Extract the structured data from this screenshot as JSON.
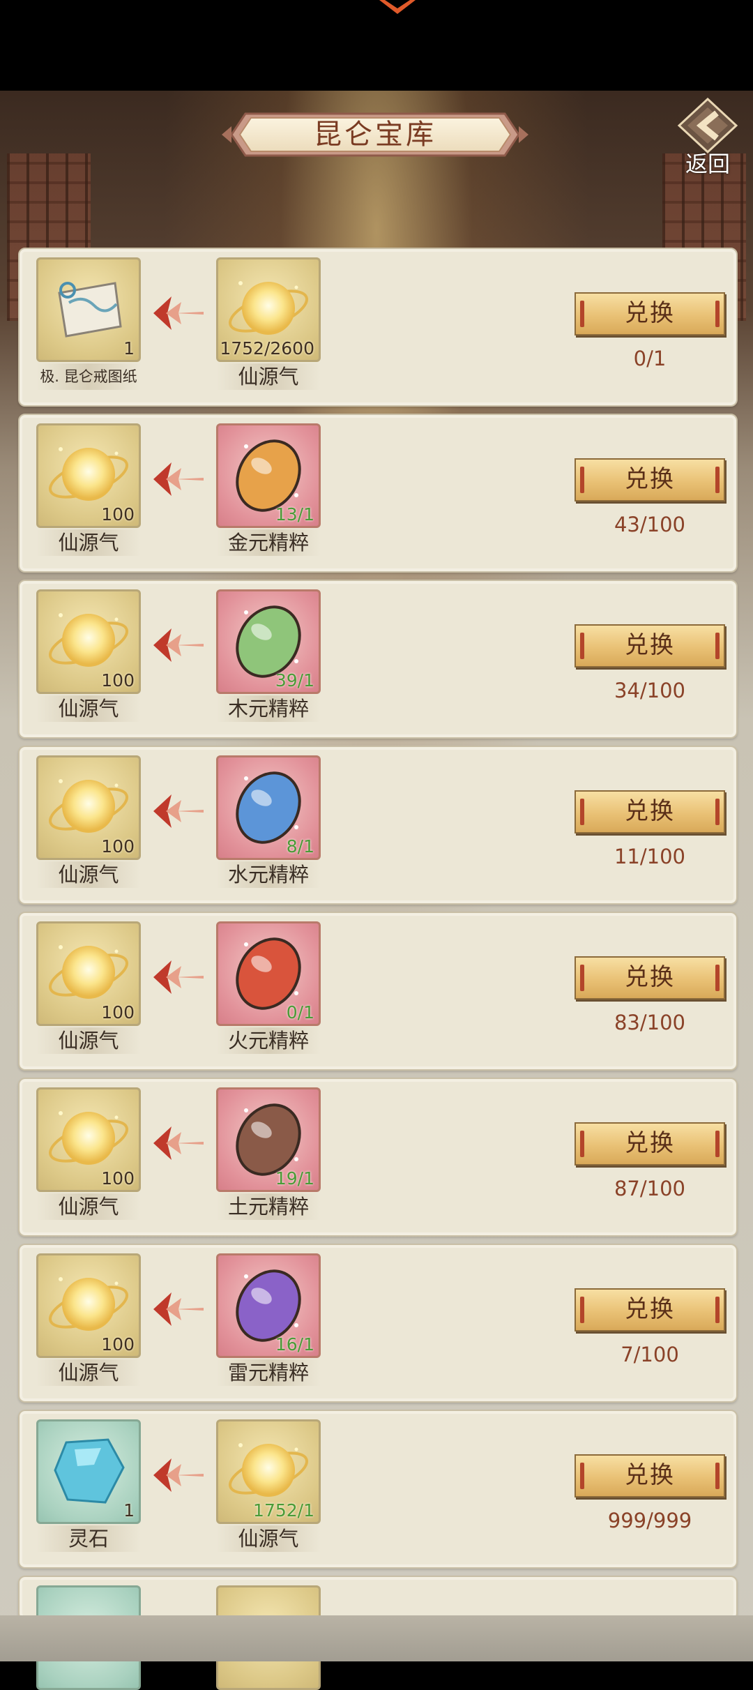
{
  "header": {
    "title": "昆仑宝库",
    "back_label": "返回"
  },
  "rows": [
    {
      "left": {
        "name": "极. 昆仑戒图纸",
        "count": "1",
        "type": "gold",
        "icon": "blueprint-icon"
      },
      "right": {
        "name": "仙源气",
        "count": "1752/2600",
        "type": "gold",
        "icon": "xianyuanqi-orb-icon"
      },
      "button": "兑换",
      "progress": "0/1"
    },
    {
      "left": {
        "name": "仙源气",
        "count": "100",
        "type": "gold",
        "icon": "xianyuanqi-orb-icon"
      },
      "right": {
        "name": "金元精粹",
        "count": "13/1",
        "type": "pink",
        "icon": "gold-essence-gem-icon",
        "gem": "#e7a24a"
      },
      "button": "兑换",
      "progress": "43/100"
    },
    {
      "left": {
        "name": "仙源气",
        "count": "100",
        "type": "gold",
        "icon": "xianyuanqi-orb-icon"
      },
      "right": {
        "name": "木元精粹",
        "count": "39/1",
        "type": "pink",
        "icon": "wood-essence-gem-icon",
        "gem": "#8fc57a"
      },
      "button": "兑换",
      "progress": "34/100"
    },
    {
      "left": {
        "name": "仙源气",
        "count": "100",
        "type": "gold",
        "icon": "xianyuanqi-orb-icon"
      },
      "right": {
        "name": "水元精粹",
        "count": "8/1",
        "type": "pink",
        "icon": "water-essence-gem-icon",
        "gem": "#5c95d8"
      },
      "button": "兑换",
      "progress": "11/100"
    },
    {
      "left": {
        "name": "仙源气",
        "count": "100",
        "type": "gold",
        "icon": "xianyuanqi-orb-icon"
      },
      "right": {
        "name": "火元精粹",
        "count": "0/1",
        "type": "pink",
        "icon": "fire-essence-gem-icon",
        "gem": "#d9543c"
      },
      "button": "兑换",
      "progress": "83/100"
    },
    {
      "left": {
        "name": "仙源气",
        "count": "100",
        "type": "gold",
        "icon": "xianyuanqi-orb-icon"
      },
      "right": {
        "name": "土元精粹",
        "count": "19/1",
        "type": "pink",
        "icon": "earth-essence-gem-icon",
        "gem": "#8a5a48"
      },
      "button": "兑换",
      "progress": "87/100"
    },
    {
      "left": {
        "name": "仙源气",
        "count": "100",
        "type": "gold",
        "icon": "xianyuanqi-orb-icon"
      },
      "right": {
        "name": "雷元精粹",
        "count": "16/1",
        "type": "pink",
        "icon": "thunder-essence-gem-icon",
        "gem": "#8a62c8"
      },
      "button": "兑换",
      "progress": "7/100"
    },
    {
      "left": {
        "name": "灵石",
        "count": "1",
        "type": "teal",
        "icon": "spirit-stone-icon"
      },
      "right": {
        "name": "仙源气",
        "count": "1752/1",
        "type": "gold",
        "icon": "xianyuanqi-orb-icon"
      },
      "button": "兑换",
      "progress": "999/999"
    }
  ],
  "colors": {
    "count_ok": "#4a9b36",
    "progress_text": "#8a4228",
    "title_text": "#7a3b22"
  }
}
